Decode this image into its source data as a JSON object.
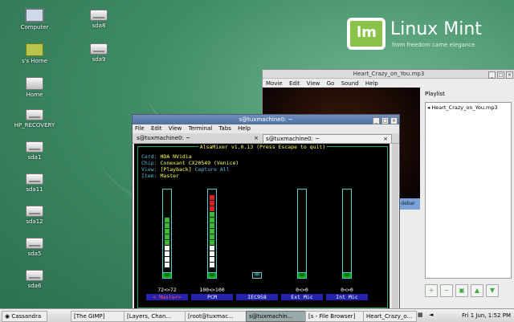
{
  "desktop": {
    "icons": [
      {
        "label": "Computer"
      },
      {
        "label": "sda8"
      },
      {
        "label": "s's Home"
      },
      {
        "label": "sda9"
      },
      {
        "label": "Home"
      },
      {
        "label": "HP_RECOVERY"
      },
      {
        "label": "sda1"
      },
      {
        "label": "sda11"
      },
      {
        "label": "sda12"
      },
      {
        "label": "sda5"
      },
      {
        "label": "sda6"
      }
    ],
    "logo": {
      "word": "Linux Mint",
      "tagline": "from freedom came elegance",
      "badge": "lm"
    }
  },
  "player": {
    "title": "Heart_Crazy_on_You.mp3",
    "menu": [
      "Movie",
      "Edit",
      "View",
      "Go",
      "Sound",
      "Help"
    ],
    "playlist_header": "Playlist",
    "playlist_items": [
      "Heart_Crazy_on_You.mp3"
    ],
    "sidebar_button": "debar"
  },
  "terminal": {
    "title": "s@tuxmachine0: ~",
    "menu": [
      "File",
      "Edit",
      "View",
      "Terminal",
      "Tabs",
      "Help"
    ],
    "tabs": [
      "s@tuxmachine0: ~",
      "s@tuxmachine0: ~"
    ],
    "mixer": {
      "title": "AlsaMixer v1.0.13 (Press Escape to quit)",
      "card_label": "Card:",
      "card": "HDA NVidia",
      "chip_label": "Chip:",
      "chip": "Conexant CX20549 (Venice)",
      "view_label": "View:",
      "view_selected": "[Playback]",
      "view_capture": "Capture",
      "view_all": "All",
      "item_label": "Item:",
      "item": "Master",
      "channels": [
        {
          "name": "< Master>",
          "volume": "72<>72",
          "level": 72,
          "mute": "OO",
          "selected": true
        },
        {
          "name": "PCM",
          "volume": "100<>100",
          "level": 100,
          "mute": "OO",
          "selected": false
        },
        {
          "name": "IEC958",
          "volume": "",
          "level": 0,
          "mute": "MM",
          "selected": false
        },
        {
          "name": "Ext Mic",
          "volume": "0<>0",
          "level": 0,
          "mute": "OO",
          "selected": false
        },
        {
          "name": "Int Mic",
          "volume": "0<>0",
          "level": 0,
          "mute": "OO",
          "selected": false
        }
      ]
    }
  },
  "taskbar": {
    "start": "Cassandra",
    "items": [
      "[The GIMP]",
      "[Layers, Chan...",
      "[root@tuxmac...",
      "s@tuxmachin...",
      "[s - File Browser]",
      "Heart_Crazy_o..."
    ],
    "clock": "Fri 1 Jun, 1:52 PM"
  },
  "colors": {
    "mixer_bar_green": "#2fbf2f",
    "mixer_bar_red": "#e02020",
    "mixer_bar_white": "#ffffff",
    "terminal_title": "#5a7aaa"
  }
}
